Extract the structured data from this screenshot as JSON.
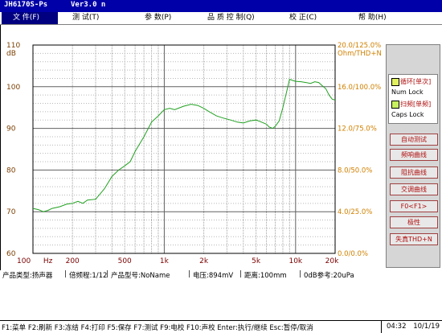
{
  "window": {
    "app": "JH6170S-Ps",
    "version": "Ver3.0 n"
  },
  "menu": [
    {
      "label": "文  件(F)"
    },
    {
      "label": "测  试(T)"
    },
    {
      "label": "参  数(P)"
    },
    {
      "label": "品  质  控  制(Q)"
    },
    {
      "label": "校  正(C)"
    },
    {
      "label": "帮  助(H)"
    }
  ],
  "legend": {
    "loop_label": "循环[单次]",
    "num_lock": "Num Lock",
    "sweep_label": "扫频[单频]",
    "caps_lock": "Caps Lock",
    "loop_color": "#e0f060",
    "sweep_color": "#c8f060"
  },
  "buttons": [
    {
      "label": "自动测试"
    },
    {
      "label": "频响曲线"
    },
    {
      "label": "阻抗曲线"
    },
    {
      "label": "交调曲线"
    },
    {
      "label": "F0<F1>"
    },
    {
      "label": "极性"
    },
    {
      "label": "失真THD+N"
    }
  ],
  "info": {
    "product_type": "产品类型:扬声器",
    "octave": "倍频程:1/12",
    "product_model": "产品型号:NoName",
    "voltage": "电压:894mV",
    "distance": "距离:100mm",
    "ref": "0dB参考:20uPa"
  },
  "status": {
    "keys": "F1:菜单  F2:刷新  F3:冻结  F4:打印  F5:保存  F7:测试  F9:电校  F10:声校  Enter:执行/继续  Esc:暂停/取消",
    "time": "04:32",
    "date": "10/1/19"
  },
  "chart_data": {
    "type": "line",
    "xscale": "log",
    "xlim": [
      100,
      20000
    ],
    "ylim": [
      60,
      110
    ],
    "yunit_left": "dB",
    "yright_unit": "Ohm/THD+N",
    "x_ticks": [
      {
        "v": 100,
        "label": "100"
      },
      {
        "v": 130,
        "label": "Hz"
      },
      {
        "v": 200,
        "label": "200"
      },
      {
        "v": 500,
        "label": "500"
      },
      {
        "v": 1000,
        "label": "1k"
      },
      {
        "v": 2000,
        "label": "2k"
      },
      {
        "v": 5000,
        "label": "5k"
      },
      {
        "v": 10000,
        "label": "10k"
      },
      {
        "v": 20000,
        "label": "20k"
      }
    ],
    "y_ticks_left": [
      110,
      100,
      90,
      80,
      70,
      60
    ],
    "y_ticks_right": [
      "20.0/125.0%",
      "16.0/100.0%",
      "12.0/75.0%",
      "8.0/50.0%",
      "4.0/25.0%",
      "0.0/0.0%"
    ],
    "series": [
      {
        "color": "#20a020",
        "x": [
          100,
          110,
          120,
          130,
          140,
          160,
          180,
          200,
          220,
          240,
          260,
          300,
          350,
          400,
          450,
          500,
          550,
          600,
          700,
          800,
          900,
          1000,
          1100,
          1200,
          1400,
          1600,
          1800,
          2000,
          2200,
          2500,
          2800,
          3200,
          3600,
          4000,
          4500,
          5000,
          5500,
          6000,
          6300,
          6700,
          7000,
          7500,
          8000,
          8500,
          9000,
          9500,
          10000,
          11000,
          12000,
          13000,
          14000,
          15000,
          16000,
          17000,
          18000,
          19000,
          20000
        ],
        "values": [
          70.8,
          70.5,
          70.0,
          70.3,
          70.8,
          71.2,
          71.8,
          72.0,
          72.5,
          72.0,
          72.8,
          73.0,
          75.5,
          78.5,
          80.0,
          81.0,
          82.0,
          84.5,
          88.0,
          91.5,
          93.0,
          94.5,
          94.8,
          94.5,
          95.3,
          95.8,
          95.5,
          94.8,
          94.0,
          93.0,
          92.5,
          92.0,
          91.5,
          91.3,
          91.8,
          92.0,
          91.5,
          91.0,
          90.3,
          90.0,
          90.5,
          91.8,
          95.0,
          98.5,
          101.8,
          101.5,
          101.3,
          101.2,
          101.0,
          100.8,
          101.2,
          101.0,
          100.2,
          99.5,
          98.0,
          97.0,
          96.8
        ]
      }
    ]
  }
}
